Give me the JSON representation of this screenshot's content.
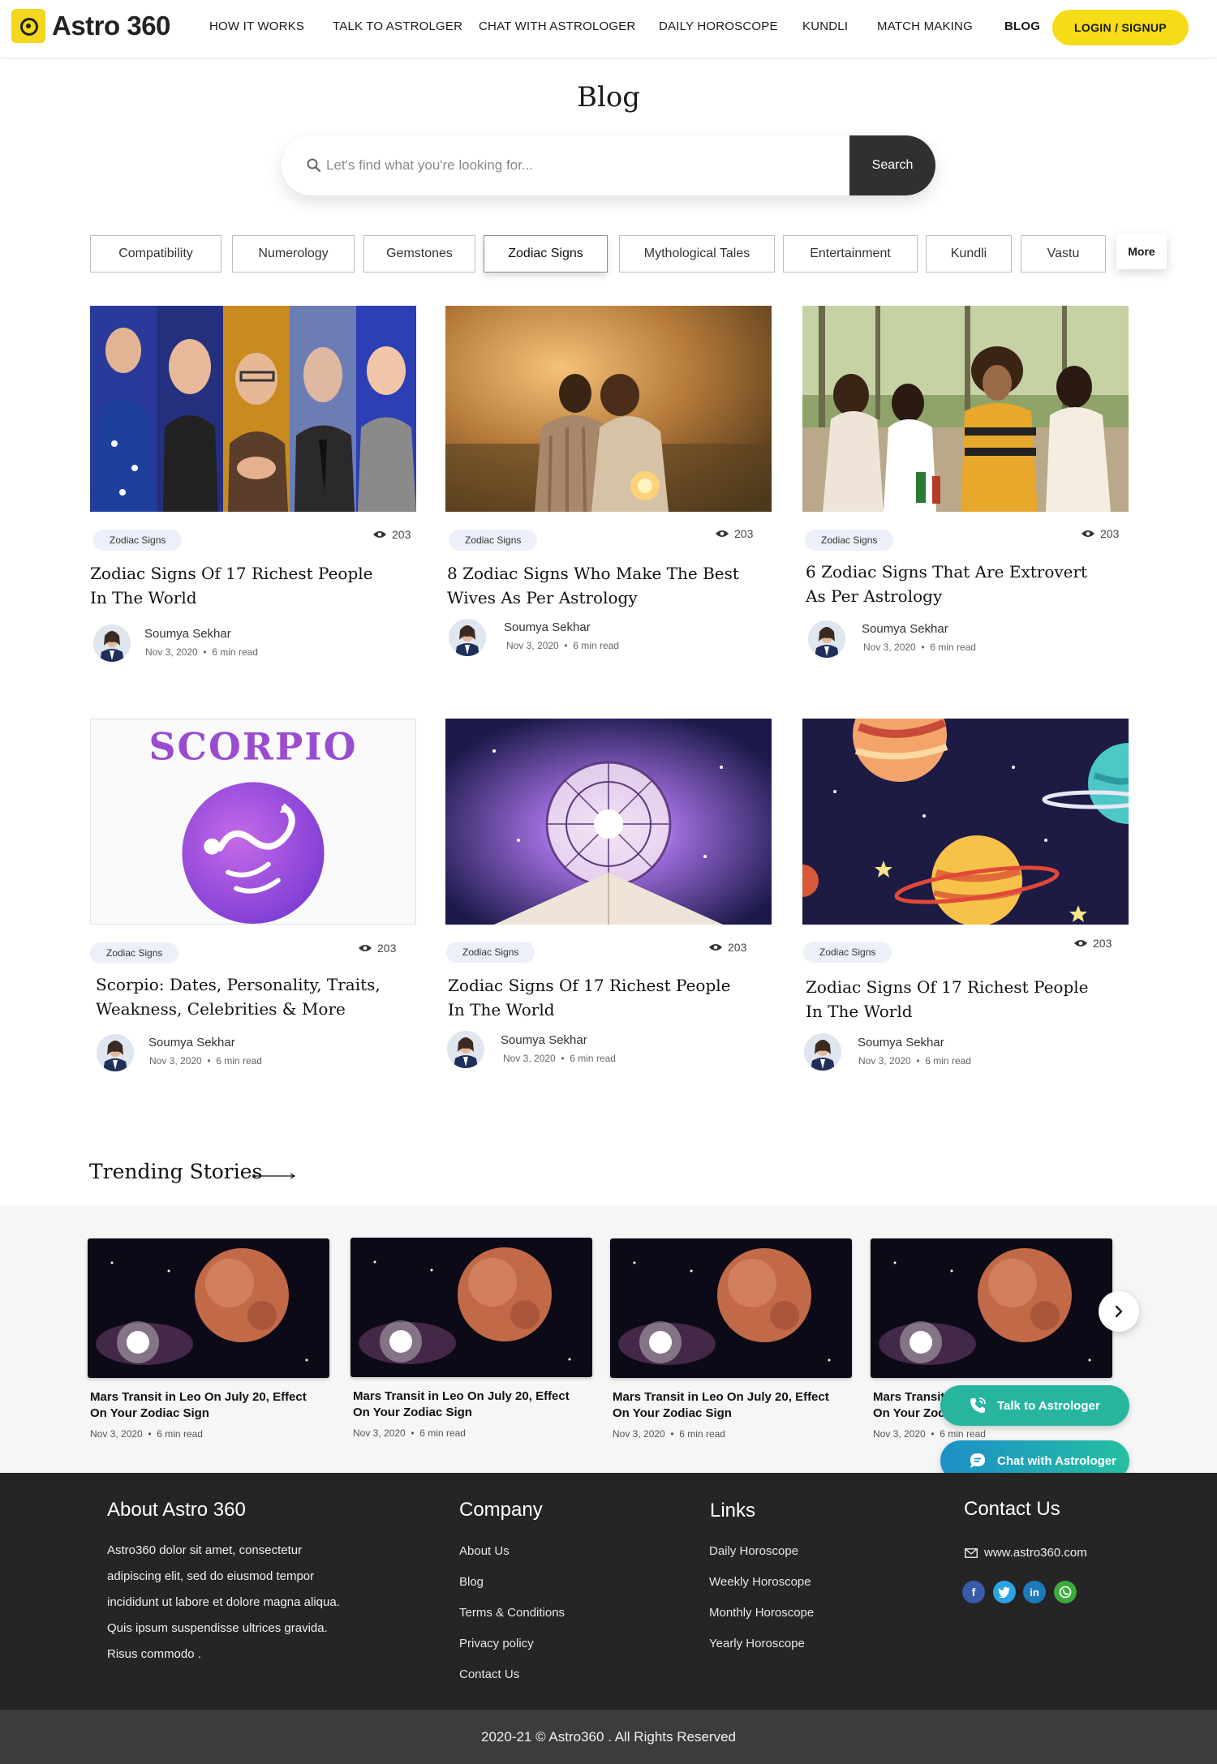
{
  "brand": {
    "name_main": "Astro 360",
    "accent": "#f5dc17"
  },
  "nav": {
    "items": [
      "How It Works",
      "Talk to Astrolger",
      "Chat with Astrologer",
      "Daily Horoscope",
      "Kundli",
      "Match Making",
      "Blog"
    ],
    "active": "Blog",
    "login_label": "LOGIN  /  SIGNUP"
  },
  "page": {
    "title": "Blog"
  },
  "search": {
    "placeholder": "Let's find what you're looking for...",
    "button": "Search",
    "icon": "search-icon"
  },
  "categories": {
    "items": [
      "Compatibility",
      "Numerology",
      "Gemstones",
      "Zodiac Signs",
      "Mythological Tales",
      "Entertainment",
      "Kundli",
      "Vastu"
    ],
    "active": "Zodiac Signs",
    "more_label": "More"
  },
  "posts": [
    {
      "tag": "Zodiac Signs",
      "views": "203",
      "title": "Zodiac Signs Of 17 Richest People In The World",
      "author": "Soumya Sekhar",
      "date": "Nov 3, 2020",
      "read": "6 min read"
    },
    {
      "tag": "Zodiac Signs",
      "views": "203",
      "title": "8 Zodiac Signs Who Make The Best Wives As Per Astrology",
      "author": "Soumya Sekhar",
      "date": "Nov 3, 2020",
      "read": "6 min read"
    },
    {
      "tag": "Zodiac Signs",
      "views": "203",
      "title": "6 Zodiac Signs That Are Extrovert As Per Astrology",
      "author": "Soumya Sekhar",
      "date": "Nov 3, 2020",
      "read": "6 min read"
    },
    {
      "tag": "Zodiac Signs",
      "views": "203",
      "title": "Scorpio: Dates, Personality, Traits, Weakness, Celebrities & More",
      "author": "Soumya Sekhar",
      "date": "Nov 3, 2020",
      "read": "6 min read",
      "image_text": "SCORPIO"
    },
    {
      "tag": "Zodiac Signs",
      "views": "203",
      "title": "Zodiac Signs Of 17 Richest People In The World",
      "author": "Soumya Sekhar",
      "date": "Nov 3, 2020",
      "read": "6 min read"
    },
    {
      "tag": "Zodiac Signs",
      "views": "203",
      "title": "Zodiac Signs Of 17 Richest People In The World",
      "author": "Soumya Sekhar",
      "date": "Nov 3, 2020",
      "read": "6 min read"
    }
  ],
  "trending": {
    "title": "Trending Stories",
    "items": [
      {
        "title": "Mars Transit in Leo On July 20, Effect On Your Zodiac Sign",
        "date": "Nov 3, 2020",
        "read": "6 min read"
      },
      {
        "title": "Mars Transit in Leo On July 20, Effect On Your Zodiac Sign",
        "date": "Nov 3, 2020",
        "read": "6 min read"
      },
      {
        "title": "Mars Transit in Leo On July 20, Effect On Your Zodiac Sign",
        "date": "Nov 3, 2020",
        "read": "6 min read"
      },
      {
        "title": "Mars Transit in Leo On July 20, Effect On Your Zodiac Sign",
        "date": "Nov 3, 2020",
        "read": "6 min read"
      }
    ]
  },
  "float": {
    "talk": "Talk to Astrologer",
    "chat": "Chat with Astrologer",
    "talk_color": "#27b5a0",
    "chat_color": "#1d8fc8"
  },
  "footer": {
    "about_title": "About Astro 360",
    "about_text": "Astro360 dolor sit amet, consectetur adipiscing elit, sed do eiusmod tempor incididunt ut labore et dolore magna aliqua. Quis ipsum suspendisse ultrices gravida. Risus commodo .",
    "company_title": "Company",
    "company_links": [
      "About Us",
      "Blog",
      "Terms & Conditions",
      "Privacy policy",
      "Contact Us"
    ],
    "links_title": "Links",
    "links": [
      "Daily Horoscope",
      "Weekly Horoscope",
      "Monthly Horoscope",
      "Yearly Horoscope"
    ],
    "contact_title": "Contact Us",
    "email": "www.astro360.com",
    "social": [
      "facebook-icon",
      "twitter-icon",
      "linkedin-icon",
      "whatsapp-icon"
    ],
    "copyright": "2020-21 © Astro360 . All Rights Reserved"
  }
}
